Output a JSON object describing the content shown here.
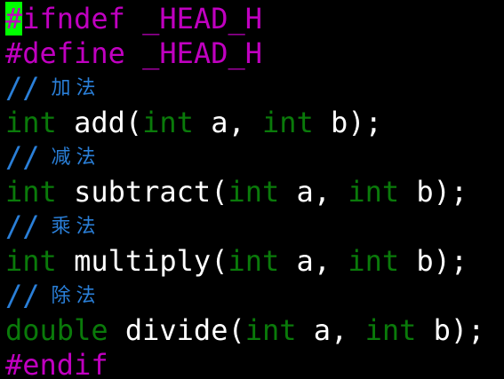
{
  "colors": {
    "background": "#000000",
    "preprocessor": "#c000c0",
    "keyword": "#0a7a0a",
    "text": "#ffffff",
    "comment": "#2a7fd8",
    "cursor": "#00ff00"
  },
  "lines": [
    {
      "cursor": "#",
      "rest": "ifndef _HEAD_H"
    },
    {
      "text": "#define _HEAD_H"
    },
    {
      "slashes": "//",
      "label": "加法"
    },
    {
      "type": "int",
      "name": " add(",
      "p1type": "int",
      "p1": " a, ",
      "p2type": "int",
      "p2": " b);"
    },
    {
      "slashes": "//",
      "label": "减法"
    },
    {
      "type": "int",
      "name": " subtract(",
      "p1type": "int",
      "p1": " a, ",
      "p2type": "int",
      "p2": " b);"
    },
    {
      "slashes": "//",
      "label": "乘法"
    },
    {
      "type": "int",
      "name": " multiply(",
      "p1type": "int",
      "p1": " a, ",
      "p2type": "int",
      "p2": " b);"
    },
    {
      "slashes": "//",
      "label": "除法"
    },
    {
      "type": "double",
      "name": " divide(",
      "p1type": "int",
      "p1": " a, ",
      "p2type": "int",
      "p2": " b);"
    },
    {
      "text": "#endif"
    }
  ]
}
